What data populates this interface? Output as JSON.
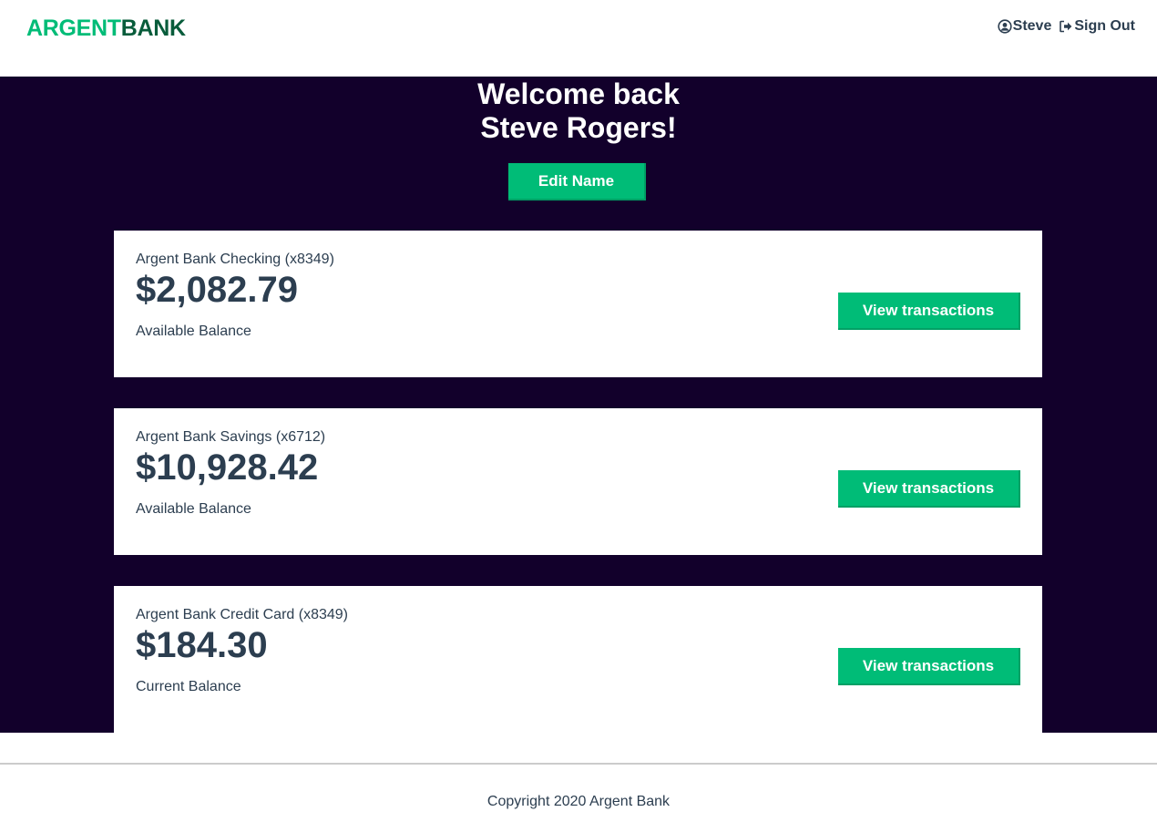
{
  "brand": {
    "part1": "ARGENT",
    "part2": "BANK"
  },
  "nav": {
    "user_label": "Steve",
    "signout_label": "Sign Out"
  },
  "header": {
    "line1": "Welcome back",
    "line2": "Steve Rogers!",
    "edit_label": "Edit Name"
  },
  "accounts": [
    {
      "title": "Argent Bank Checking (x8349)",
      "amount": "$2,082.79",
      "description": "Available Balance",
      "button_label": "View transactions"
    },
    {
      "title": "Argent Bank Savings (x6712)",
      "amount": "$10,928.42",
      "description": "Available Balance",
      "button_label": "View transactions"
    },
    {
      "title": "Argent Bank Credit Card (x8349)",
      "amount": "$184.30",
      "description": "Current Balance",
      "button_label": "View transactions"
    }
  ],
  "footer": {
    "text": "Copyright 2020 Argent Bank"
  },
  "colors": {
    "accent": "#00bc77",
    "brand_dark": "#085c3b",
    "background_dark": "#12002b",
    "text": "#2c3e50"
  }
}
